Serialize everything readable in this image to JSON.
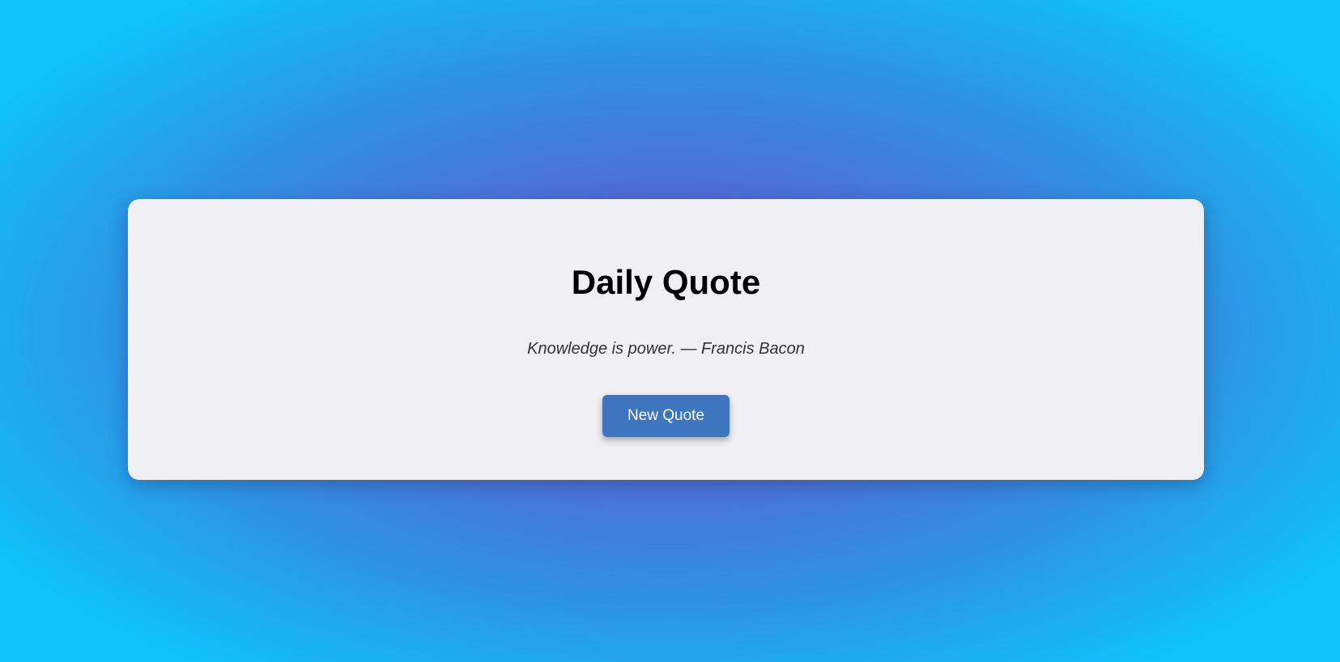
{
  "card": {
    "title": "Daily Quote",
    "quote": "Knowledge is power. — Francis Bacon",
    "button_label": "New Quote"
  },
  "colors": {
    "button_bg": "#3d76bf",
    "card_bg": "#f0eff3",
    "gradient_center": "#6a4fc4",
    "gradient_edge": "#0fc2f8"
  }
}
